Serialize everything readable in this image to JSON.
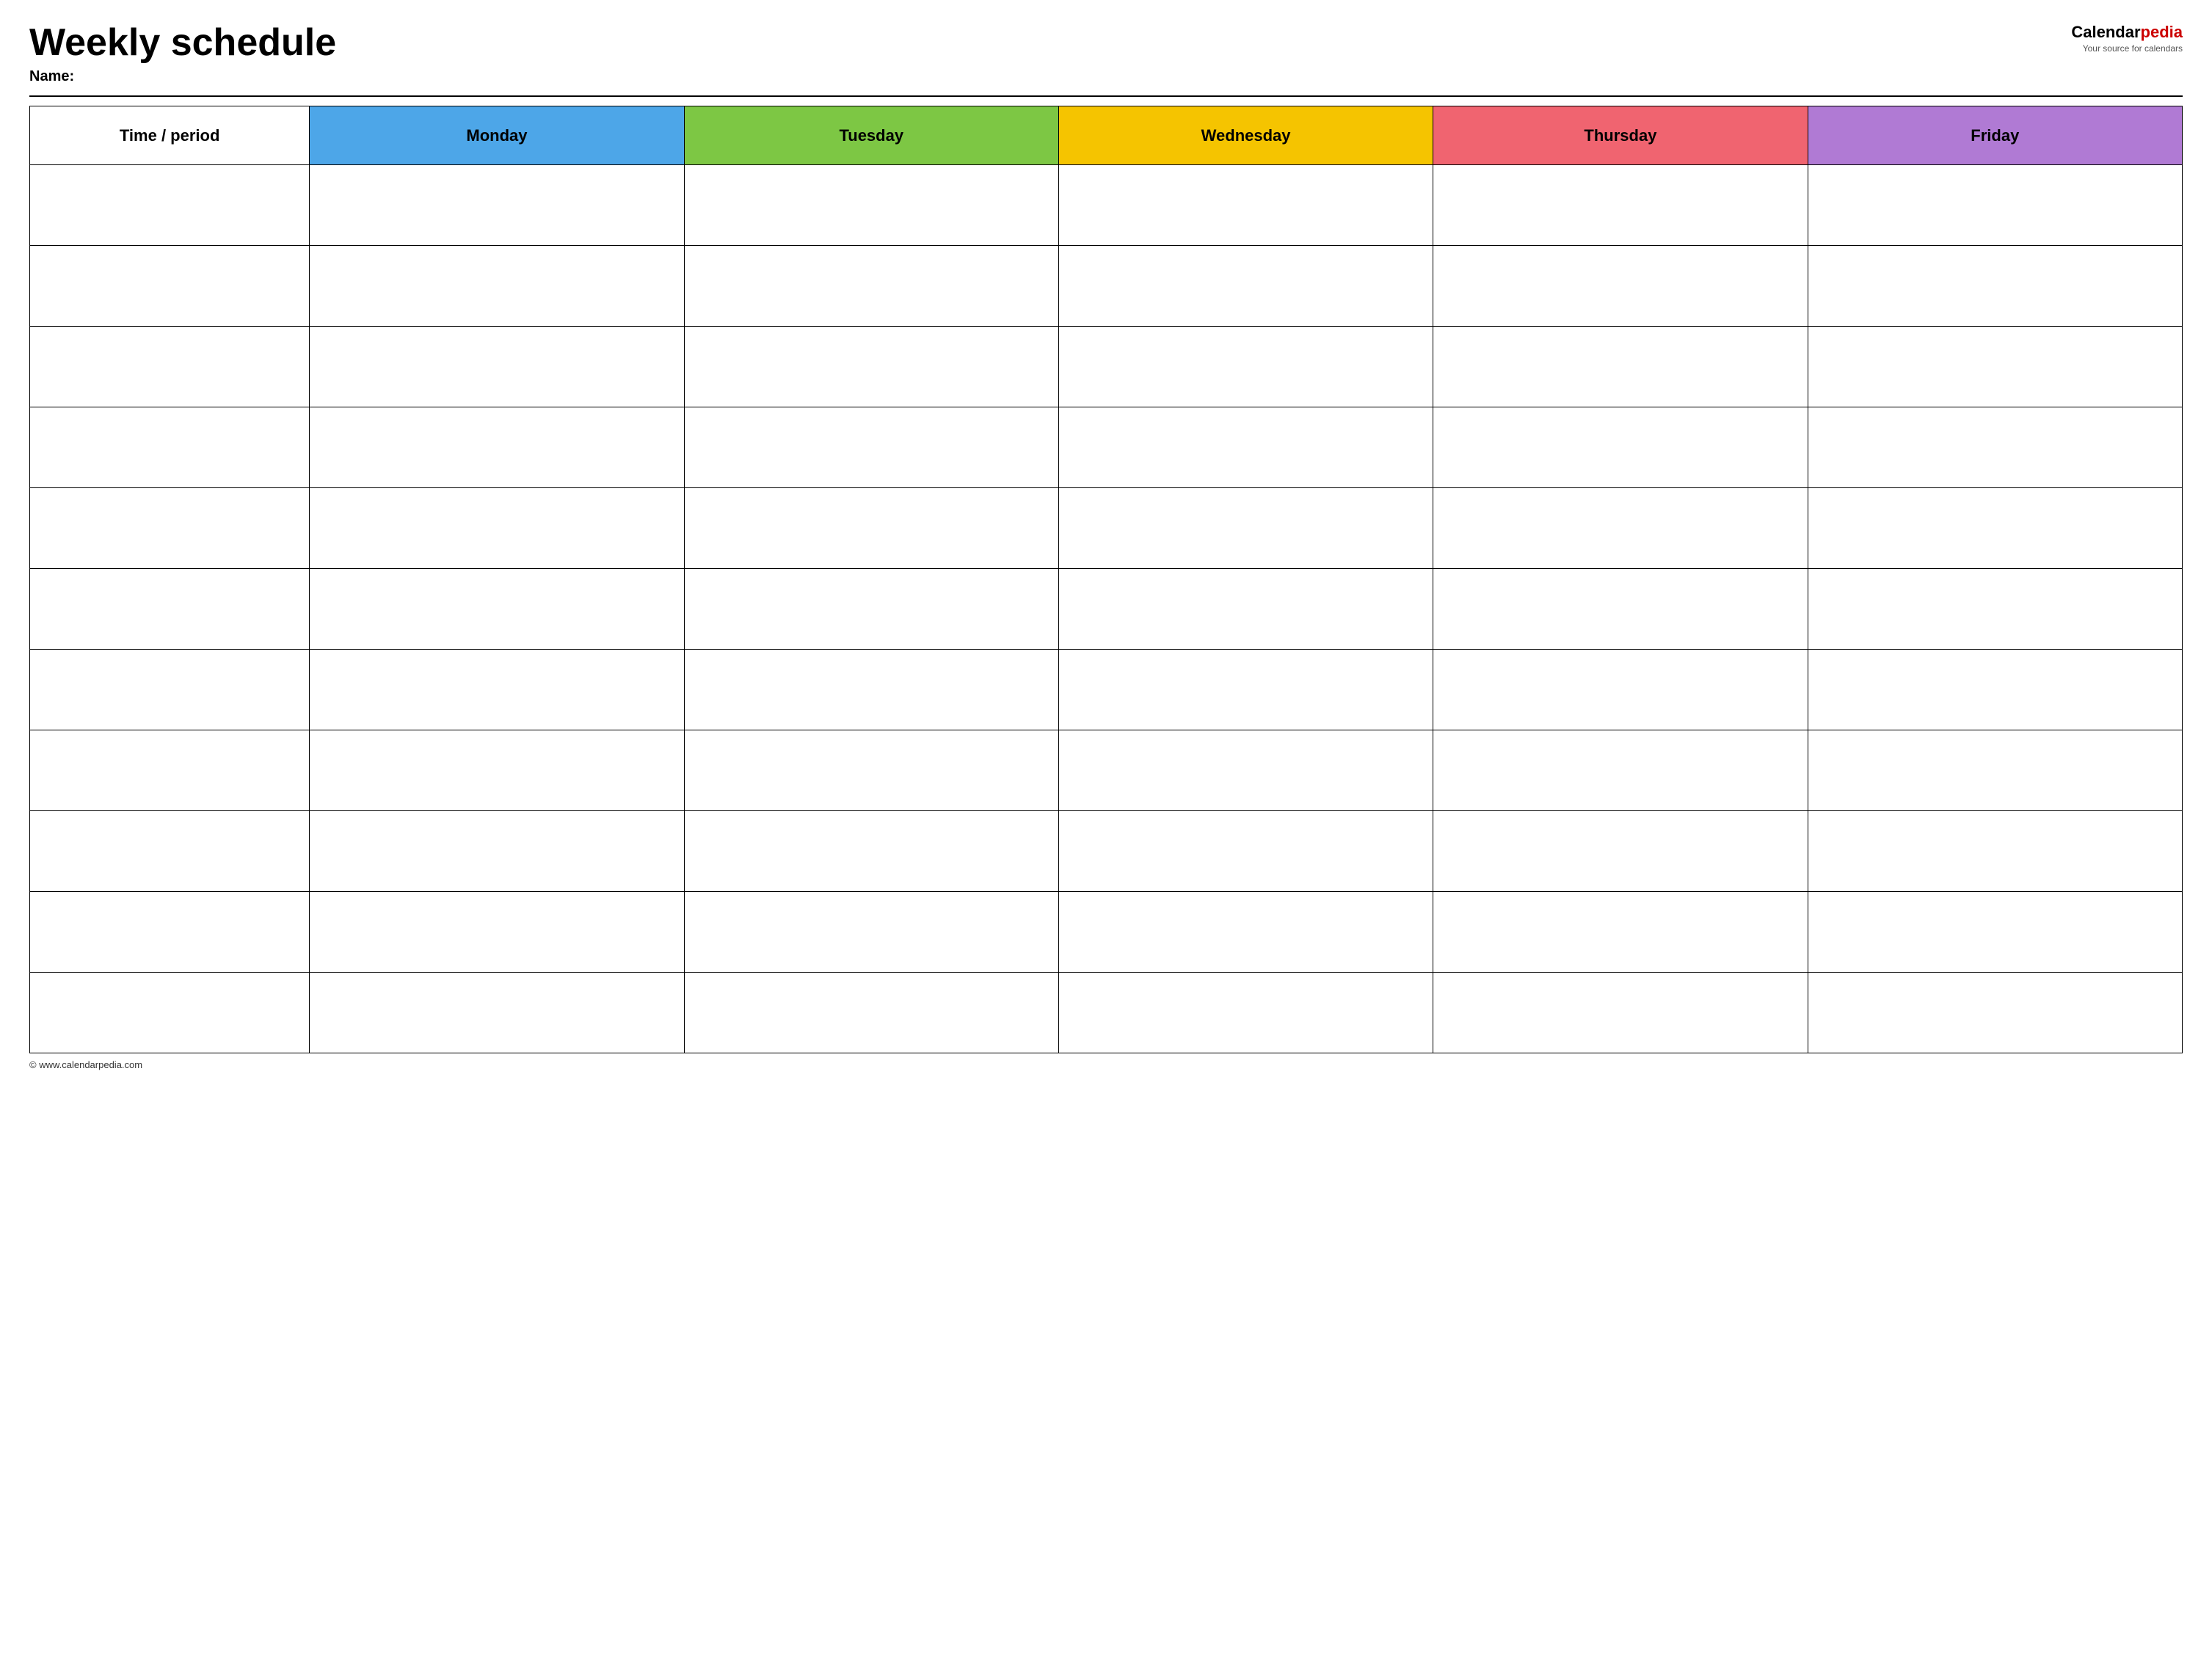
{
  "header": {
    "title": "Weekly schedule",
    "name_label": "Name:",
    "logo_calendar": "Calendar",
    "logo_pedia": "pedia",
    "logo_tagline": "Your source for calendars"
  },
  "table": {
    "headers": [
      {
        "id": "time",
        "label": "Time / period",
        "class": "th-time"
      },
      {
        "id": "monday",
        "label": "Monday",
        "class": "th-monday"
      },
      {
        "id": "tuesday",
        "label": "Tuesday",
        "class": "th-tuesday"
      },
      {
        "id": "wednesday",
        "label": "Wednesday",
        "class": "th-wednesday"
      },
      {
        "id": "thursday",
        "label": "Thursday",
        "class": "th-thursday"
      },
      {
        "id": "friday",
        "label": "Friday",
        "class": "th-friday"
      }
    ],
    "row_count": 11
  },
  "footer": {
    "copyright": "© www.calendarpedia.com"
  }
}
